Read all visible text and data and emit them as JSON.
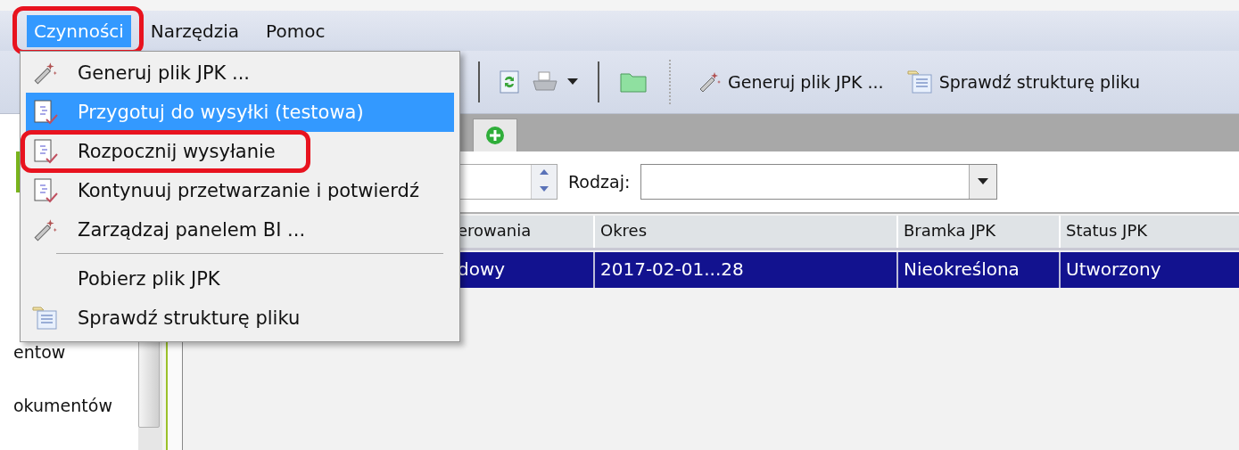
{
  "menu_bar": [
    {
      "label": "Czynności",
      "selected": true,
      "highlighted": true
    },
    {
      "label": "Narzędzia",
      "selected": false,
      "highlighted": false
    },
    {
      "label": "Pomoc",
      "selected": false,
      "highlighted": false
    }
  ],
  "menu": [
    {
      "kind": "wand",
      "label": "Generuj plik JPK ...",
      "selected": false,
      "highlighted": false
    },
    {
      "kind": "document",
      "label": "Przygotuj do wysyłki (testowa)",
      "selected": true,
      "highlighted": false
    },
    {
      "kind": "document",
      "label": "Rozpocznij wysyłanie",
      "selected": false,
      "highlighted": true
    },
    {
      "kind": "document",
      "label": "Kontynuuj przetwarzanie i potwierdź",
      "selected": false,
      "highlighted": false
    },
    {
      "kind": "wand",
      "label": "Zarządzaj panelem BI ...",
      "selected": false,
      "highlighted": false
    },
    {
      "kind": "separator"
    },
    {
      "kind": "plain",
      "label": "Pobierz plik JPK",
      "selected": false,
      "highlighted": false
    },
    {
      "kind": "structure",
      "label": "Sprawdź strukturę pliku",
      "selected": false,
      "highlighted": false
    }
  ],
  "toolbar": {
    "buttons": [
      {
        "kind": "wand",
        "label": "Generuj plik JPK ..."
      },
      {
        "kind": "structure",
        "label": "Sprawdź strukturę pliku"
      }
    ]
  },
  "sidebar": {
    "items": [
      "entow",
      "okumentów"
    ]
  },
  "filter": {
    "label": "Rodzaj:"
  },
  "table": {
    "columns": [
      "erowania",
      "Okres",
      "Bramka JPK",
      "Status JPK"
    ],
    "rows": [
      {
        "cells": [
          "dowy",
          "2017-02-01...28",
          "Nieokreślona",
          "Utworzony"
        ],
        "selected": true
      }
    ]
  }
}
